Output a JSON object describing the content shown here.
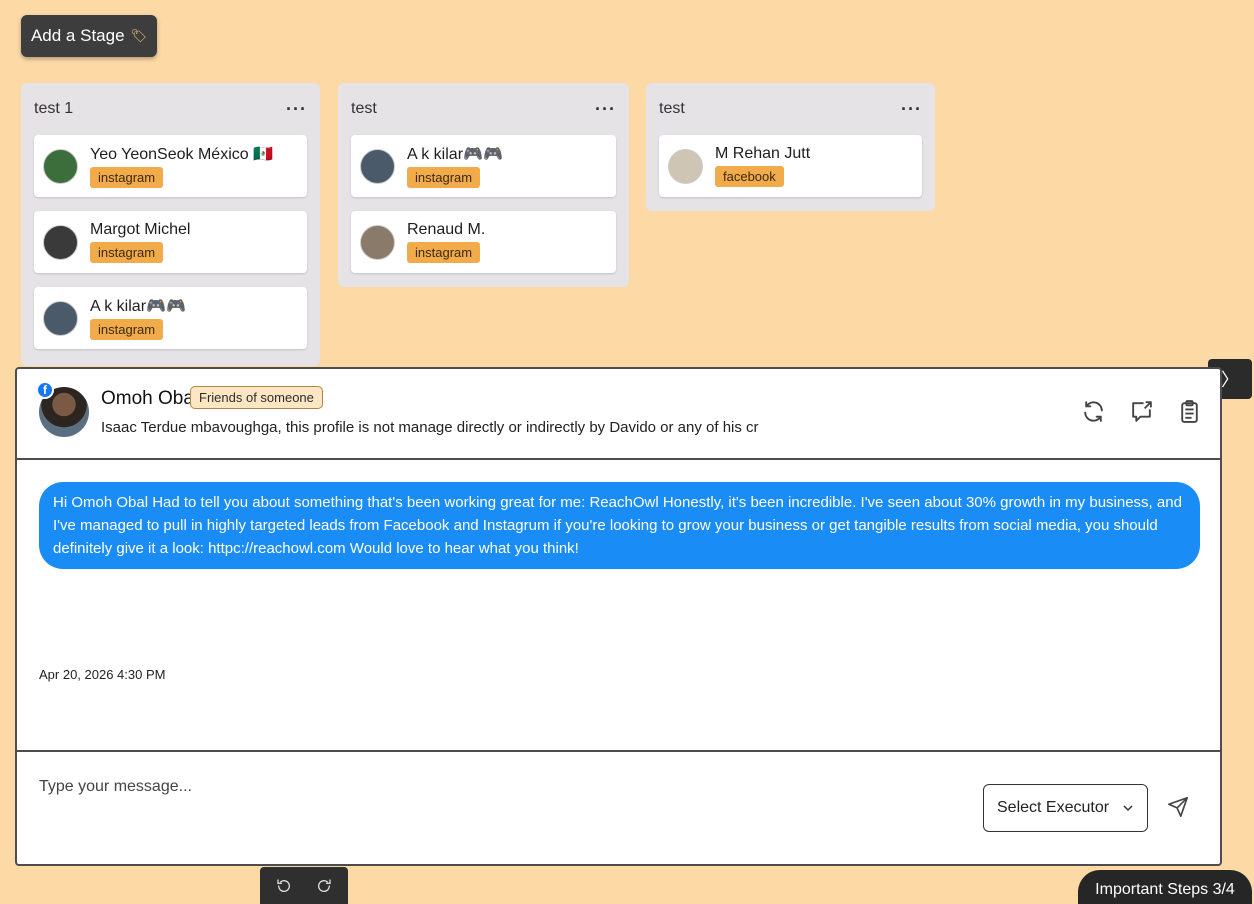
{
  "toolbar": {
    "add_stage_label": "Add a Stage",
    "tag_icon": "tag-icon"
  },
  "stages": [
    {
      "title": "test 1",
      "menu": "···",
      "cards": [
        {
          "name": "Yeo YeonSeok México 🇲🇽",
          "platform": "instagram",
          "avatar_color": "#3b6e3a"
        },
        {
          "name": "Margot Michel",
          "platform": "instagram",
          "avatar_color": "#3a3a3a"
        },
        {
          "name": "A k kilar🎮🎮",
          "platform": "instagram",
          "avatar_color": "#4a5a6a"
        }
      ]
    },
    {
      "title": "test",
      "menu": "···",
      "cards": [
        {
          "name": "A k kilar🎮🎮",
          "platform": "instagram",
          "avatar_color": "#4a5a6a"
        },
        {
          "name": "Renaud M.",
          "platform": "instagram",
          "avatar_color": "#8a7a6a"
        }
      ]
    },
    {
      "title": "test",
      "menu": "···",
      "cards": [
        {
          "name": "M Rehan Jutt",
          "platform": "facebook",
          "avatar_color": "#cfc5b5"
        }
      ]
    }
  ],
  "conversation": {
    "contact_name": "Omoh Oba",
    "relation_badge": "Friends of someone",
    "bio": "Isaac Terdue mbavoughga, this profile is not manage directly or indirectly by Davido or any of his cr",
    "network_icon_letter": "f",
    "message": "Hi Omoh Obal Had to tell you about something that's been working great for me: ReachOwl Honestly, it's been incredible. I've seen about 30% growth in my business, and I've managed to pull in highly targeted leads from Facebook and Instagrum if you're looking to grow your business or get tangible results from social media, you should definitely give it a look: httpc://reachowl.com Would love to hear what you think!",
    "timestamp": "Apr 20, 2026 4:30 PM"
  },
  "composer": {
    "placeholder": "Type your message...",
    "executor_label": "Select Executor",
    "chevron": "⌄"
  },
  "side_tab": {
    "label": "〉"
  },
  "steps": {
    "label": "Important Steps 3/4"
  },
  "colors": {
    "bubble": "#1a8cf5",
    "badge": "#f2ab4a",
    "background": "#fdd9a6"
  }
}
